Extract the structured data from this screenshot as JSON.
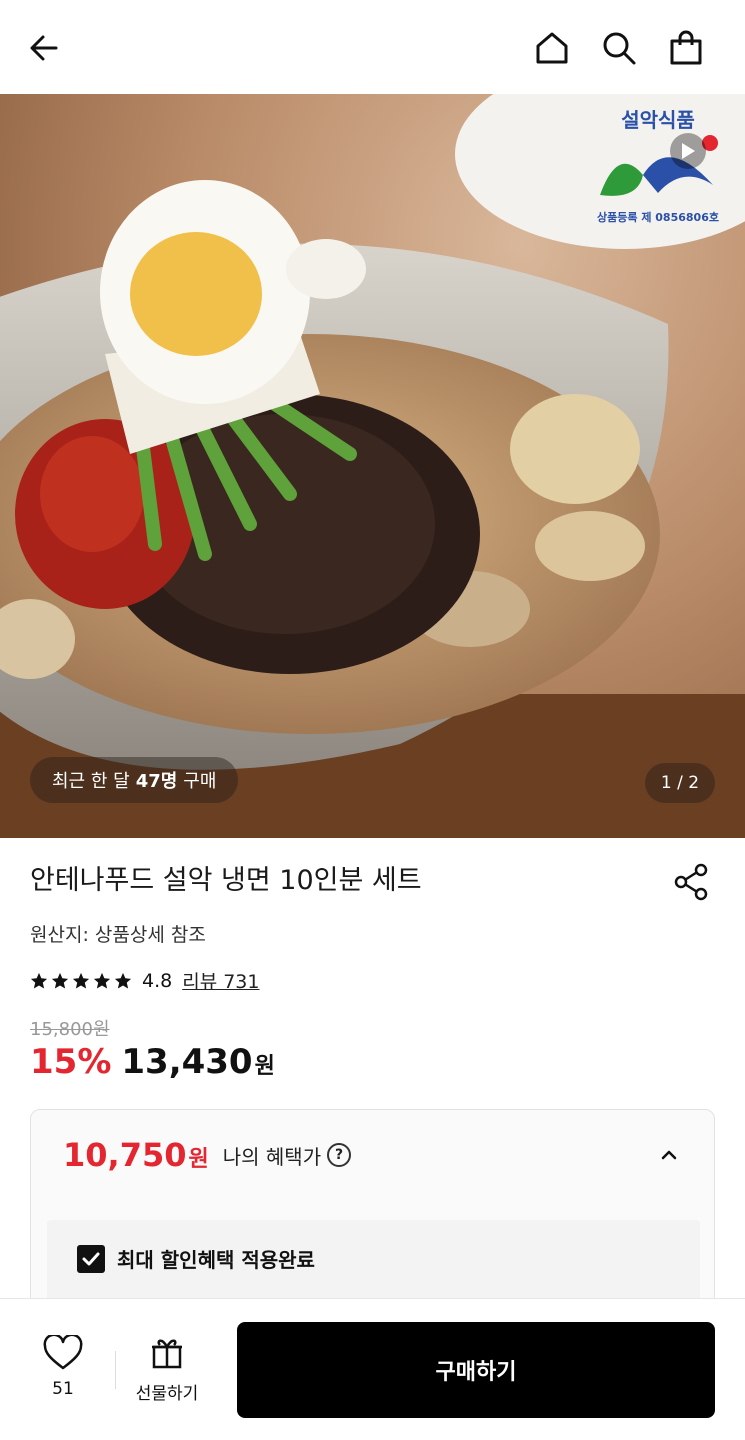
{
  "header": {
    "back_icon": "arrow-left-icon",
    "home_icon": "home-icon",
    "search_icon": "search-icon",
    "cart_icon": "shopping-bag-icon"
  },
  "hero": {
    "brand_name": "설악식품",
    "brand_reg": "상품등록 제 0856806호",
    "recent_prefix": "최근 한 달",
    "recent_count": "47명",
    "recent_suffix": "구매",
    "counter": "1 / 2"
  },
  "product": {
    "title": "안테나푸드 설악 냉면 10인분 세트",
    "origin": "원산지: 상품상세 참조",
    "rating": "4.8",
    "stars": 5,
    "review_link": "리뷰 731",
    "original_price": "15,800원",
    "discount": "15%",
    "price": "13,430",
    "won": "원"
  },
  "benefit": {
    "price": "10,750",
    "won": "원",
    "label": "나의 혜택가",
    "help": "?",
    "check_label": "최대 할인혜택 적용완료"
  },
  "bottom": {
    "like_count": "51",
    "gift_label": "선물하기",
    "buy_label": "구매하기"
  },
  "colors": {
    "accent": "#e3262f",
    "button": "#000000"
  }
}
